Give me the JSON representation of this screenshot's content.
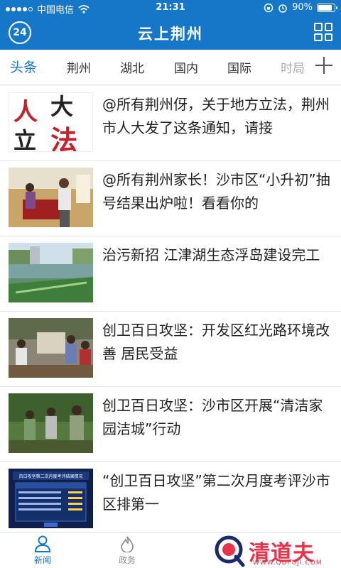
{
  "status": {
    "carrier": "中国电信",
    "time": "21:31",
    "battery": "90%",
    "battery_level": 0.9
  },
  "header": {
    "title": "云上荆州",
    "logo_text": "24"
  },
  "tabs": [
    {
      "label": "头条"
    },
    {
      "label": "荆州"
    },
    {
      "label": "湖北"
    },
    {
      "label": "国内"
    },
    {
      "label": "国际"
    },
    {
      "label": "时局"
    }
  ],
  "news": [
    {
      "title": "@所有荆州伢，关于地方立法，荆州市人大发了这条通知，请接",
      "thumb_text": "人大立法"
    },
    {
      "title": "@所有荆州家长！沙市区“小升初”抽号结果出炉啦！看看你的"
    },
    {
      "title": "治污新招 江津湖生态浮岛建设完工"
    },
    {
      "title": "创卫百日攻坚：开发区红光路环境改善 居民受益"
    },
    {
      "title": "创卫百日攻坚：沙市区开展“清洁家园洁城”行动"
    },
    {
      "title": "“创卫百日攻坚”第二次月度考评沙市区排第一",
      "thumb_text": "百日攻坚第二次月度考评结果情况"
    }
  ],
  "bottom_nav": [
    {
      "label": "新闻"
    },
    {
      "label": "政务"
    }
  ],
  "watermark": {
    "main": "清道夫",
    "sub": "WWW.QDFUJI.COM"
  },
  "colors": {
    "brand": "#1677c8",
    "watermark": "#e8334a"
  }
}
